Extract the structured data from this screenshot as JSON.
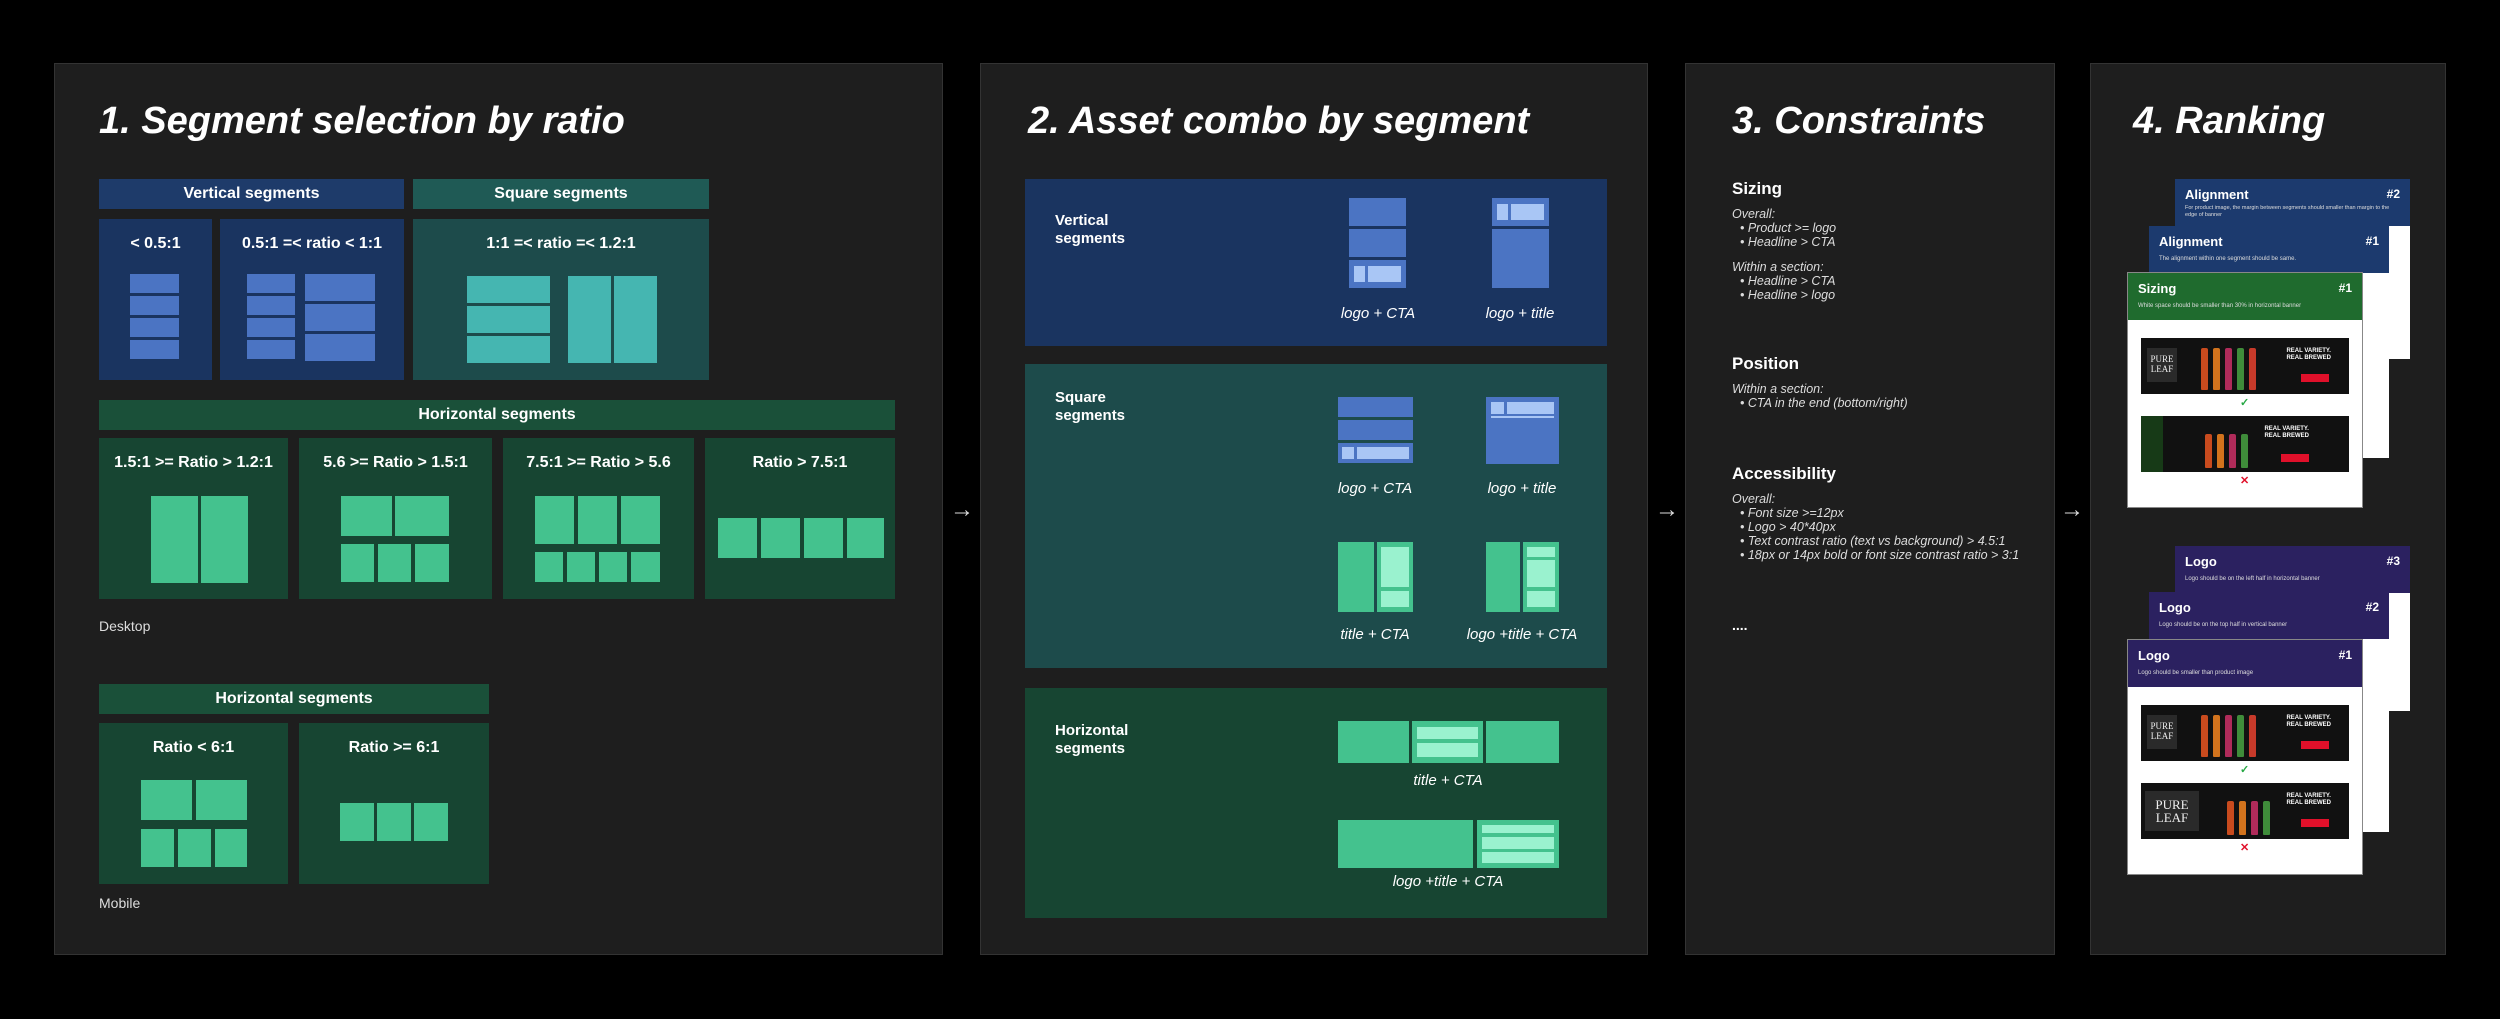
{
  "panel1": {
    "title": "1. Segment selection by ratio",
    "vertical_header": "Vertical segments",
    "square_header": "Square segments",
    "v1_label": "< 0.5:1",
    "v2_label": "0.5:1 =< ratio < 1:1",
    "sq_label": "1:1 =< ratio =< 1.2:1",
    "horizontal_header": "Horizontal segments",
    "h1_label": "1.5:1 >= Ratio > 1.2:1",
    "h2_label": "5.6 >= Ratio > 1.5:1",
    "h3_label": "7.5:1 >= Ratio > 5.6",
    "h4_label": "Ratio > 7.5:1",
    "desktop_label": "Desktop",
    "mobile_header": "Horizontal segments",
    "m1_label": "Ratio < 6:1",
    "m2_label": "Ratio >= 6:1",
    "mobile_label": "Mobile"
  },
  "panel2": {
    "title": "2. Asset combo by segment",
    "vertical_label": "Vertical\nsegments",
    "square_label": "Square\nsegments",
    "horizontal_label": "Horizontal\nsegments",
    "v_cap1": "logo + CTA",
    "v_cap2": "logo + title",
    "s_cap1": "logo + CTA",
    "s_cap2": "logo + title",
    "s_cap3": "title + CTA",
    "s_cap4": "logo +title + CTA",
    "h_cap1": "title + CTA",
    "h_cap2": "logo +title + CTA"
  },
  "panel3": {
    "title": "3. Constraints",
    "sizing_title": "Sizing",
    "sizing_overall": "Overall:",
    "sizing_b1": "•  Product >= logo",
    "sizing_b2": "•  Headline > CTA",
    "sizing_within": "Within a section:",
    "sizing_b3": "•  Headline > CTA",
    "sizing_b4": "•  Headline > logo",
    "position_title": "Position",
    "position_within": "Within a section:",
    "position_b1": "•  CTA in the end (bottom/right)",
    "access_title": "Accessibility",
    "access_overall": "Overall:",
    "access_b1": "•  Font size >=12px",
    "access_b2": "•  Logo > 40*40px",
    "access_b3": "•  Text contrast ratio (text vs background) > 4.5:1",
    "access_b4": "•  18px or 14px bold or font size contrast ratio > 3:1",
    "ellipsis": "...."
  },
  "panel4": {
    "title": "4. Ranking",
    "card_a2_title": "Alignment",
    "card_a2_rank": "#2",
    "card_a2_desc": "For product image, the margin between segments should smaller than margin to the edge of banner",
    "card_a1_title": "Alignment",
    "card_a1_rank": "#1",
    "card_a1_desc": "The alignment within one segment should be same.",
    "card_s_title": "Sizing",
    "card_s_rank": "#1",
    "card_s_desc": "White space should be smaller than 30% in horizontal banner",
    "card_l3_title": "Logo",
    "card_l3_rank": "#3",
    "card_l3_desc": "Logo should be on the left half in horizontal banner",
    "card_l2_title": "Logo",
    "card_l2_rank": "#2",
    "card_l2_desc": "Logo should be on the top half in vertical banner",
    "card_l1_title": "Logo",
    "card_l1_rank": "#1",
    "card_l1_desc": "Logo should be smaller than product image",
    "banner_logo": "PURE\nLEAF",
    "banner_text": "REAL VARIETY.\nREAL BREWED",
    "banner_text_short": "REAL VARIETY.\nREAL BREWED",
    "check": "✓",
    "cross": "✕"
  },
  "arrows": {
    "a1": "→",
    "a2": "→",
    "a3": "→"
  },
  "colors": {
    "vertical_bg": "#1a3460",
    "square_bg": "#1d4b4b",
    "horizontal_bg": "#174532",
    "blue_block": "#4b74c3",
    "teal_block": "#45b6b1",
    "green_block": "#44c28e",
    "alignment_header": "#1c3a6e",
    "sizing_header": "#1f6b2e",
    "logo_header": "#2b2160"
  }
}
